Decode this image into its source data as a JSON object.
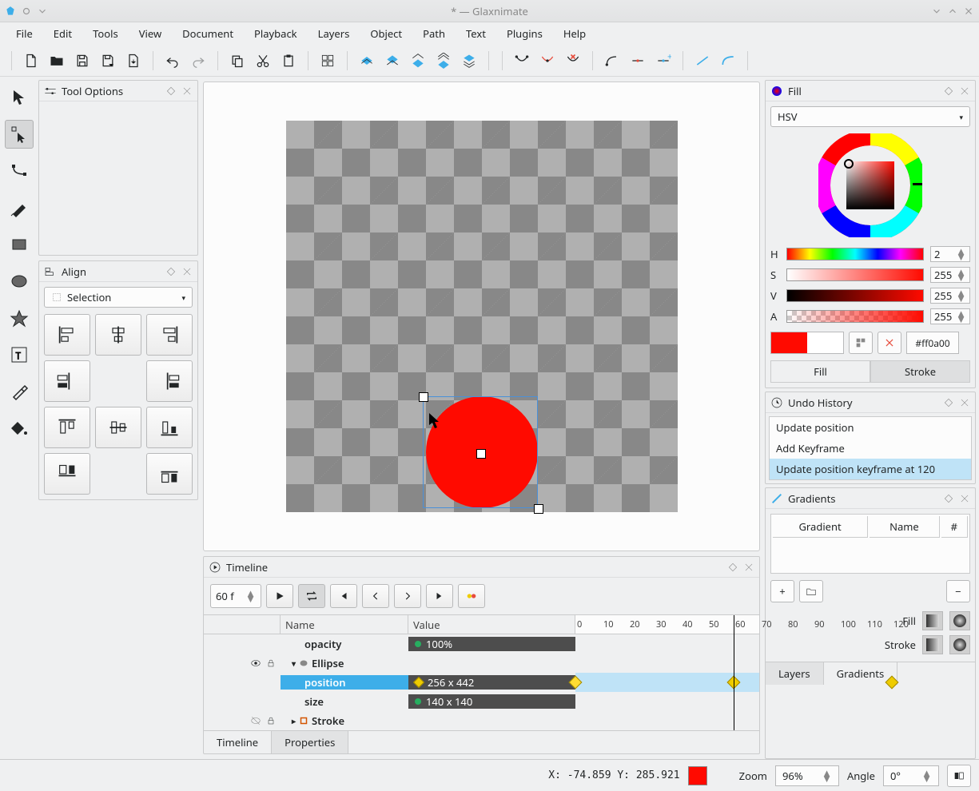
{
  "window": {
    "title": "* — Glaxnimate"
  },
  "menu": [
    "File",
    "Edit",
    "Tools",
    "View",
    "Document",
    "Playback",
    "Layers",
    "Object",
    "Path",
    "Text",
    "Plugins",
    "Help"
  ],
  "panels": {
    "tool_options": "Tool Options",
    "align": "Align",
    "align_mode": "Selection",
    "timeline": "Timeline",
    "fill": "Fill",
    "undo": "Undo History",
    "gradients": "Gradients"
  },
  "timeline": {
    "frame": "60 f",
    "headers": {
      "name": "Name",
      "value": "Value"
    },
    "rows": {
      "opacity": {
        "label": "opacity",
        "value": "100%"
      },
      "ellipse": {
        "label": "Ellipse"
      },
      "position": {
        "label": "position",
        "value": "256 x 442"
      },
      "size": {
        "label": "size",
        "value": "140 x 140"
      },
      "stroke": {
        "label": "Stroke"
      }
    },
    "ruler_ticks": [
      0,
      10,
      20,
      30,
      40,
      50,
      60,
      70,
      80,
      90,
      100,
      110,
      120
    ],
    "playhead_frame": 60,
    "keyframes_position": [
      0,
      60,
      120
    ],
    "tabs": {
      "timeline": "Timeline",
      "properties": "Properties"
    }
  },
  "fill": {
    "mode": "HSV",
    "h": "2",
    "s": "255",
    "v": "255",
    "a": "255",
    "hex": "#ff0a00",
    "tabs": {
      "fill": "Fill",
      "stroke": "Stroke"
    }
  },
  "undo": {
    "items": [
      "Update position",
      "Add Keyframe",
      "Update position keyframe at 120"
    ],
    "selected": 2
  },
  "gradients": {
    "headers": [
      "Gradient",
      "Name",
      "#"
    ],
    "fillstroke": {
      "fill": "Fill",
      "stroke": "Stroke"
    },
    "tabs": {
      "layers": "Layers",
      "gradients": "Gradients"
    }
  },
  "status": {
    "xy": "X:  -74.859 Y:  285.921",
    "zoom_label": "Zoom",
    "zoom": "96%",
    "angle_label": "Angle",
    "angle": "0°"
  }
}
